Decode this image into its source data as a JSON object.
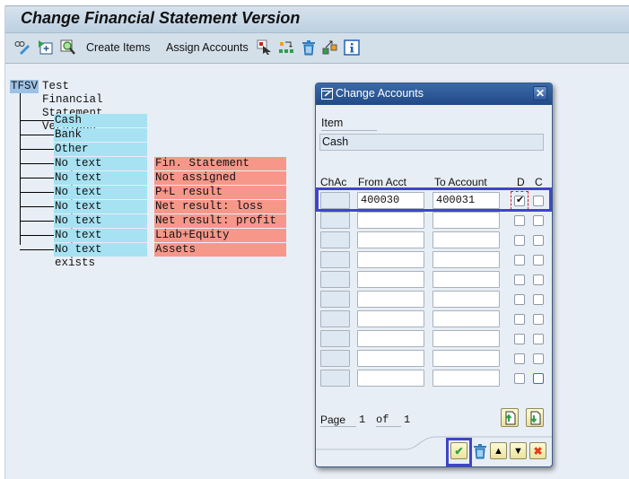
{
  "window": {
    "title": "Change Financial Statement Version"
  },
  "toolbar": {
    "icons": [
      "display-change-icon",
      "expand-icon",
      "find-icon"
    ],
    "create_items": "Create Items",
    "assign_accounts": "Assign Accounts",
    "right_icons": [
      "select-icon",
      "reassign-icon",
      "delete-icon",
      "move-icon",
      "info-icon"
    ]
  },
  "tree": {
    "root_code": "TFSV",
    "root_text": "Test Financial Statement Versions",
    "nodes": [
      {
        "text": "Cash",
        "text2": ""
      },
      {
        "text": "Bank",
        "text2": ""
      },
      {
        "text": "Other",
        "text2": ""
      },
      {
        "text": "No text exists",
        "text2": "Fin. Statement Notes"
      },
      {
        "text": "No text exists",
        "text2": "Not assigned"
      },
      {
        "text": "No text exists",
        "text2": "P+L result"
      },
      {
        "text": "No text exists",
        "text2": "Net result: loss"
      },
      {
        "text": "No text exists",
        "text2": "Net result: profit"
      },
      {
        "text": "No text exists",
        "text2": "Liab+Equity"
      },
      {
        "text": "No text exists",
        "text2": "Assets"
      }
    ]
  },
  "dialog": {
    "title": "Change Accounts",
    "item_label": "Item",
    "item_value": "Cash",
    "columns": {
      "chac": "ChAc",
      "from": "From Acct",
      "to": "To Account",
      "d": "D",
      "c": "C"
    },
    "rows": [
      {
        "chac": "",
        "from": "400030",
        "to": "400031",
        "d": true,
        "c": false
      },
      {
        "chac": "",
        "from": "",
        "to": "",
        "d": false,
        "c": false
      },
      {
        "chac": "",
        "from": "",
        "to": "",
        "d": false,
        "c": false
      },
      {
        "chac": "",
        "from": "",
        "to": "",
        "d": false,
        "c": false
      },
      {
        "chac": "",
        "from": "",
        "to": "",
        "d": false,
        "c": false
      },
      {
        "chac": "",
        "from": "",
        "to": "",
        "d": false,
        "c": false
      },
      {
        "chac": "",
        "from": "",
        "to": "",
        "d": false,
        "c": false
      },
      {
        "chac": "",
        "from": "",
        "to": "",
        "d": false,
        "c": false
      },
      {
        "chac": "",
        "from": "",
        "to": "",
        "d": false,
        "c": false
      },
      {
        "chac": "",
        "from": "",
        "to": "",
        "d": false,
        "c": false
      }
    ],
    "page_label": "Page",
    "page_current": "1",
    "of_label": "of",
    "page_total": "1",
    "close_glyph": "✕",
    "buttons": {
      "ok": "✔",
      "delete": "🗑",
      "up": "▲",
      "down": "▼",
      "cancel": "✖"
    }
  },
  "colors": {
    "accent": "#3f45c9",
    "node_blue": "#a6e2f2",
    "node_red": "#f7978a",
    "dialog_title": "#2a5594"
  }
}
